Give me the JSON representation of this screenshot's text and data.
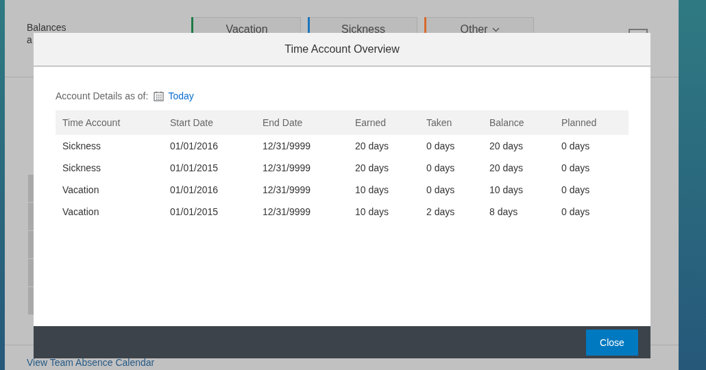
{
  "background": {
    "balances_label": "Balances",
    "as_label": "a",
    "tabs": [
      {
        "label": "Vacation",
        "color": "#1e7a46",
        "has_menu": false
      },
      {
        "label": "Sickness",
        "color": "#1b75bb",
        "has_menu": false
      },
      {
        "label": "Other",
        "color": "#d86a2c",
        "has_menu": true
      }
    ],
    "link": "View Team Absence Calendar"
  },
  "dialog": {
    "title": "Time Account Overview",
    "details_label": "Account Details as of:",
    "date_link": "Today",
    "columns": [
      "Time Account",
      "Start Date",
      "End Date",
      "Earned",
      "Taken",
      "Balance",
      "Planned"
    ],
    "rows": [
      [
        "Sickness",
        "01/01/2016",
        "12/31/9999",
        "20 days",
        "0 days",
        "20 days",
        "0 days"
      ],
      [
        "Sickness",
        "01/01/2015",
        "12/31/9999",
        "20 days",
        "0 days",
        "20 days",
        "0 days"
      ],
      [
        "Vacation",
        "01/01/2016",
        "12/31/9999",
        "10 days",
        "0 days",
        "10 days",
        "0 days"
      ],
      [
        "Vacation",
        "01/01/2015",
        "12/31/9999",
        "10 days",
        "2 days",
        "8 days",
        "0 days"
      ]
    ],
    "close_button": "Close"
  }
}
